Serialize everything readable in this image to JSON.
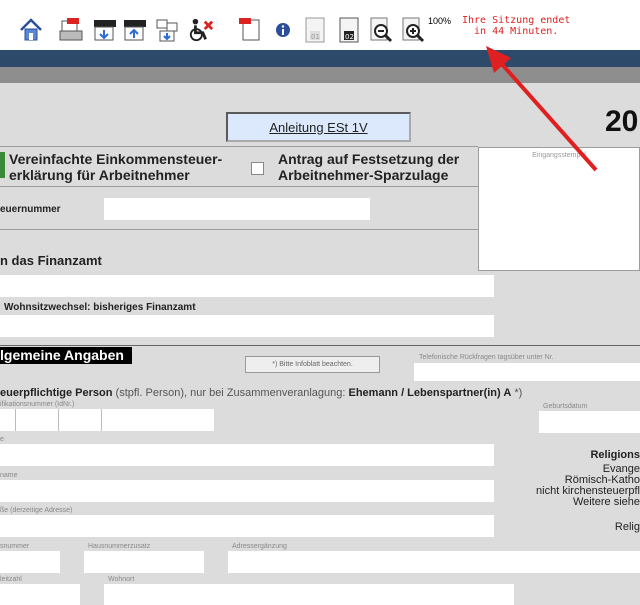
{
  "toolbar": {
    "zoom_label": "100%",
    "session_line1": "Ihre Sitzung endet",
    "session_line2": "in 44 Minuten.",
    "icons": [
      "home-icon",
      "pdf-print-icon",
      "xml-export-icon",
      "xml-import-icon",
      "network-icon",
      "accessibility-off-icon",
      "pdf-icon",
      "info-icon",
      "page-01-icon",
      "page-02-icon",
      "zoom-out-icon",
      "zoom-in-icon"
    ]
  },
  "form": {
    "anleitung": "Anleitung ESt 1V",
    "year": "20",
    "vereinfacht": "Vereinfachte Einkommensteuer-",
    "vereinfacht2": "erklärung für Arbeitnehmer",
    "antrag": "Antrag auf Festsetzung der",
    "antrag2": "Arbeitnehmer-Sparzulage",
    "eingang": "Eingangsstempel",
    "steuernummer": "euernummer",
    "finanzamt": "n das Finanzamt",
    "wohnsitz": "Wohnsitzwechsel: bisheriges Finanzamt",
    "allgemein": "lgemeine Angaben",
    "infoblatt": "*) Bitte Infoblatt beachten.",
    "telefon": "Telefonische Rückfragen tagsüber unter Nr.",
    "person_bold": "euerpflichtige Person",
    "person_rest": " (stpfl. Person), nur bei Zusammenveranlagung: ",
    "person_bold2": "Ehemann / Lebenspartner(in) A",
    "person_star": " *)",
    "idnr": "ifikationsnummer (IdNr.)",
    "geburtsdatum": "Geburtsdatum",
    "name1": "e",
    "name2": "name",
    "religion_title": "Religions",
    "religion1": "Evange",
    "religion2": "Römisch-Katho",
    "religion3": "nicht kirchensteuerpfl",
    "religion4": "Weitere siehe",
    "religion5": "Relig",
    "strasse": "ße (derzeitige Adresse)",
    "hausnummer": "snummer",
    "hausnummerzusatz": "Hausnummerzusatz",
    "adressergaenzung": "Adressergänzung",
    "postleitzahl": "leitzahl",
    "wohnort": "Wohnort"
  },
  "colors": {
    "session": "#e02020",
    "banner": "#2e4a6b",
    "arrow": "#e02020"
  }
}
